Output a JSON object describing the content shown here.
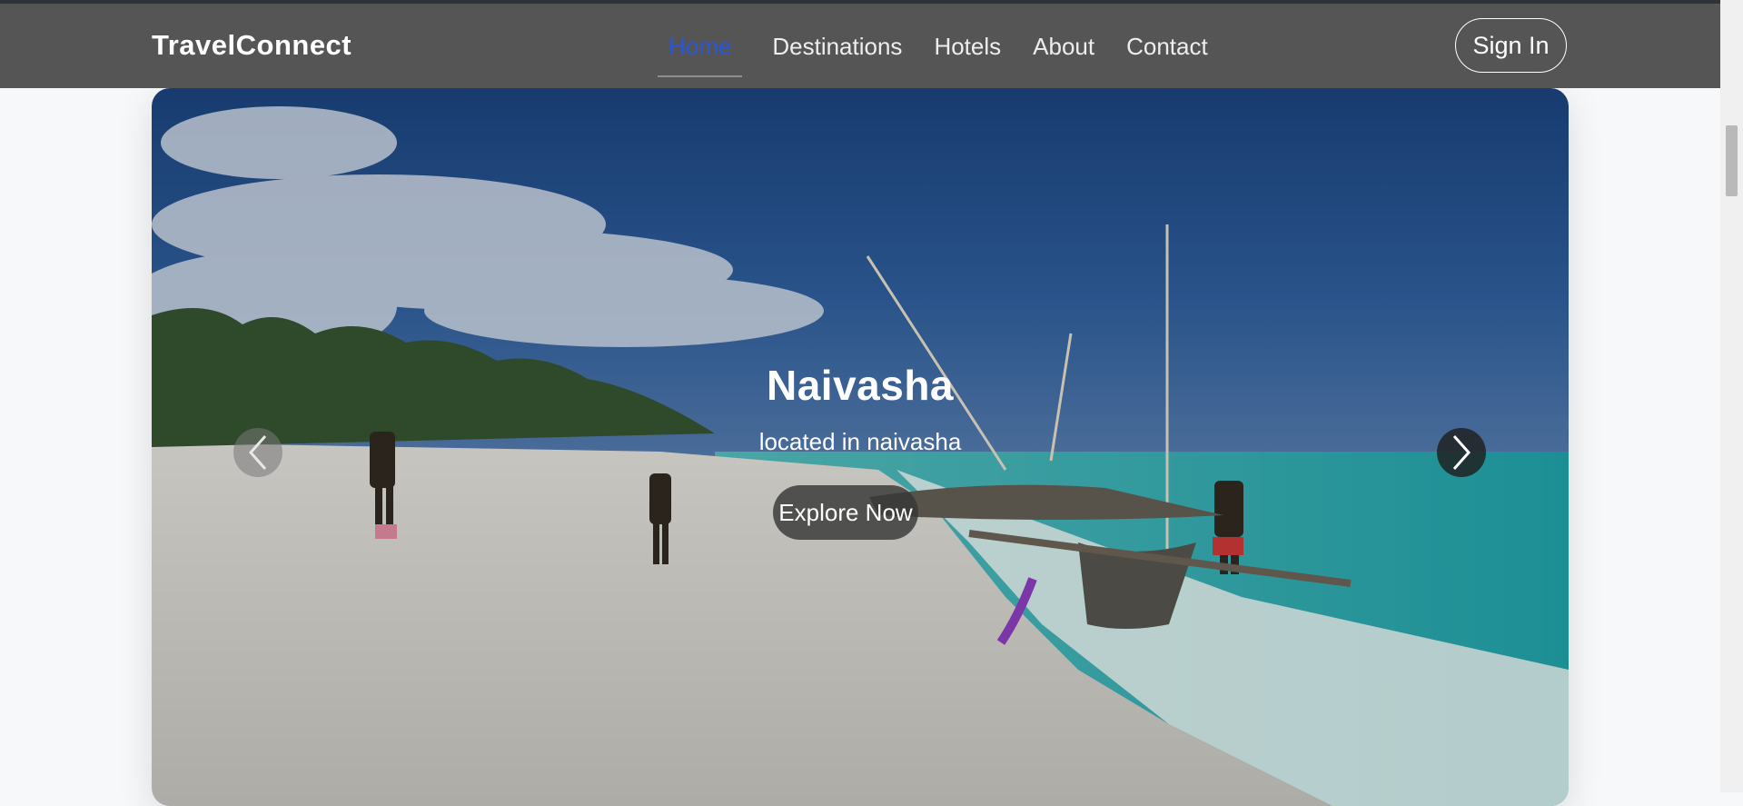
{
  "brand": "TravelConnect",
  "nav": [
    {
      "label": "Home",
      "active": true
    },
    {
      "label": "Destinations",
      "active": false
    },
    {
      "label": "Hotels",
      "active": false
    },
    {
      "label": "About",
      "active": false
    },
    {
      "label": "Contact",
      "active": false
    }
  ],
  "auth": {
    "signin_label": "Sign In"
  },
  "hero": {
    "title": "Naivasha",
    "subtitle": "located in naivasha",
    "cta_label": "Explore Now",
    "prev_icon": "chevron-left-icon",
    "next_icon": "chevron-right-icon"
  },
  "colors": {
    "navbar": "#555555",
    "active_link": "#2957d8",
    "page_bg": "#f7f8fa"
  }
}
